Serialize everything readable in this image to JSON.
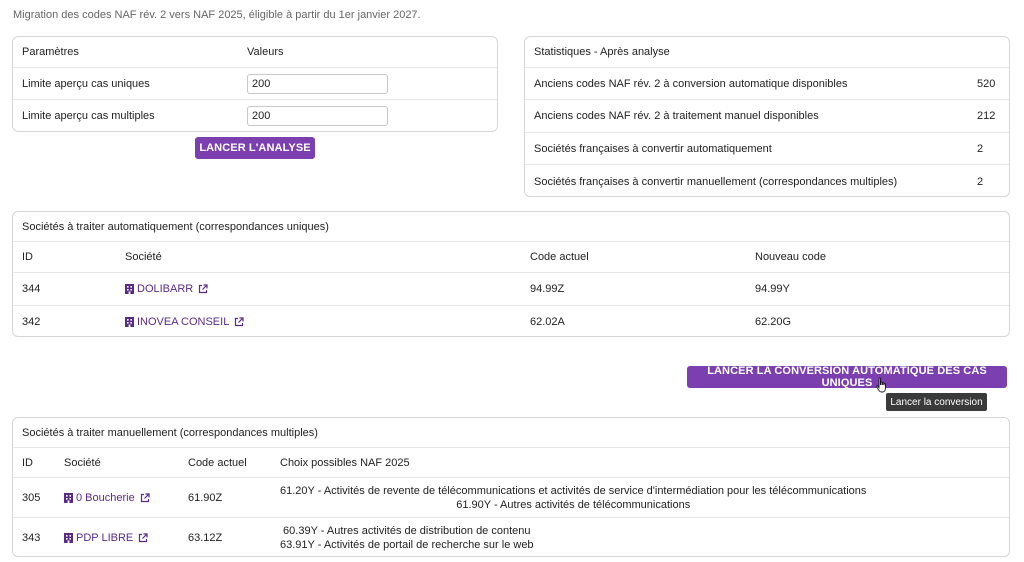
{
  "intro_text": "Migration des codes NAF rév. 2 vers NAF 2025, éligible à partir du 1er janvier 2027.",
  "params": {
    "header_param": "Paramètres",
    "header_values": "Valeurs",
    "rows": [
      {
        "label": "Limite aperçu cas uniques",
        "value": "200"
      },
      {
        "label": "Limite aperçu cas multiples",
        "value": "200"
      }
    ],
    "analyze_button": "LANCER L'ANALYSE"
  },
  "stats": {
    "title": "Statistiques - Après analyse",
    "rows": [
      {
        "label": "Anciens codes NAF rév. 2 à conversion automatique disponibles",
        "value": "520"
      },
      {
        "label": "Anciens codes NAF rév. 2 à traitement manuel disponibles",
        "value": "212"
      },
      {
        "label": "Sociétés françaises à convertir automatiquement",
        "value": "2"
      },
      {
        "label": "Sociétés françaises à convertir manuellement (correspondances multiples)",
        "value": "2"
      }
    ]
  },
  "auto_table": {
    "title": "Sociétés à traiter automatiquement (correspondances uniques)",
    "headers": {
      "id": "ID",
      "company": "Société",
      "current": "Code actuel",
      "new": "Nouveau code"
    },
    "rows": [
      {
        "id": "344",
        "company": "DOLIBARR",
        "current": "94.99Z",
        "new": "94.99Y"
      },
      {
        "id": "342",
        "company": "INOVEA CONSEIL",
        "current": "62.02A",
        "new": "62.20G"
      }
    ]
  },
  "convert_button": "LANCER LA CONVERSION AUTOMATIQUE DES CAS UNIQUES",
  "tooltip": "Lancer la conversion",
  "manual_table": {
    "title": "Sociétés à traiter manuellement (correspondances multiples)",
    "headers": {
      "id": "ID",
      "company": "Société",
      "current": "Code actuel",
      "choices": "Choix possibles NAF 2025"
    },
    "rows": [
      {
        "id": "305",
        "company": "0 Boucherie",
        "current": "61.90Z",
        "choice1": "61.20Y - Activités de revente de télécommunications et activités de service d'intermédiation pour les télécommunications",
        "choice2": "61.90Y - Autres activités de télécommunications"
      },
      {
        "id": "343",
        "company": "PDP LIBRE",
        "current": "63.12Z",
        "choice1": "60.39Y - Autres activités de distribution de contenu",
        "choice2": "63.91Y - Activités de portail de recherche sur le web"
      }
    ]
  },
  "colors": {
    "accent": "#7b3fb0",
    "link": "#5a2a87"
  }
}
